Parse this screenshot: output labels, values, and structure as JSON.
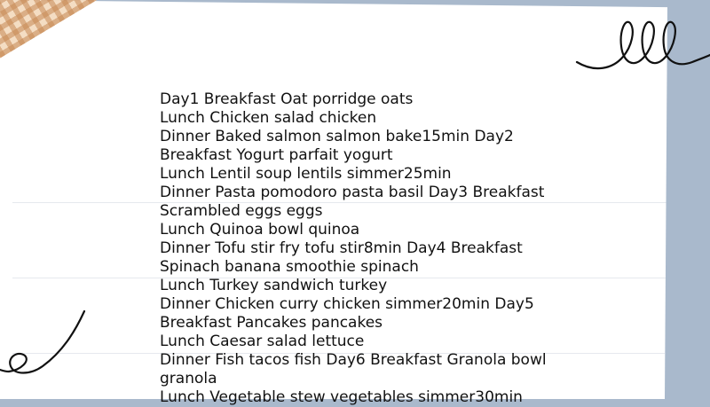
{
  "background_color": "#a9b9cc",
  "paper_color": "#ffffff",
  "decorations": [
    "gingham-tape",
    "squiggle-doodle",
    "swirl-doodle"
  ],
  "meal_plan": {
    "lines": [
      "Day1 Breakfast Oat porridge oats",
      "Lunch Chicken salad chicken",
      "Dinner Baked salmon salmon bake15min Day2",
      "Breakfast Yogurt parfait yogurt",
      "Lunch Lentil soup lentils simmer25min",
      "Dinner Pasta pomodoro pasta basil Day3 Breakfast",
      "Scrambled eggs eggs",
      "Lunch Quinoa bowl quinoa",
      "Dinner Tofu stir fry tofu stir8min Day4 Breakfast",
      "Spinach banana smoothie spinach",
      "Lunch Turkey sandwich turkey",
      "Dinner Chicken curry chicken simmer20min Day5",
      "Breakfast Pancakes pancakes",
      "Lunch Caesar salad lettuce",
      "Dinner Fish tacos fish Day6 Breakfast Granola bowl",
      "granola",
      "Lunch Vegetable stew vegetables simmer30min"
    ]
  }
}
